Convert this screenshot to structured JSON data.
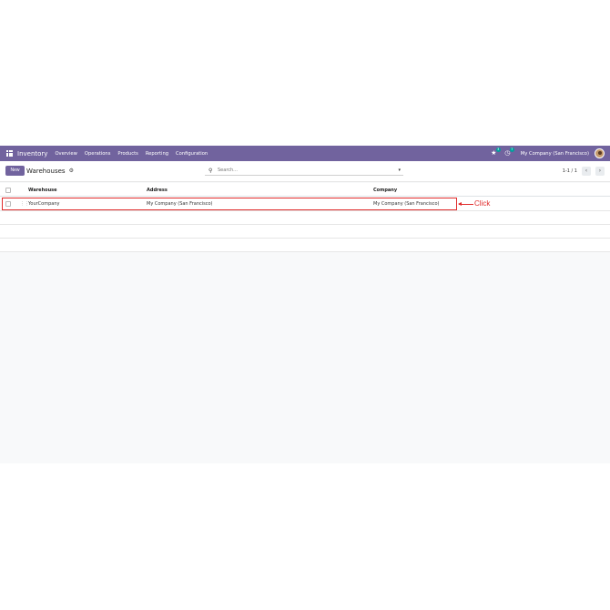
{
  "navbar": {
    "app_name": "Inventory",
    "menu": [
      "Overview",
      "Operations",
      "Products",
      "Reporting",
      "Configuration"
    ],
    "chat_badge": "3",
    "activity_badge": "7",
    "company": "My Company (San Francisco)"
  },
  "controlbar": {
    "new_label": "New",
    "title": "Warehouses",
    "search_placeholder": "Search...",
    "pager": "1-1 / 1"
  },
  "table": {
    "headers": [
      "Warehouse",
      "Address",
      "Company"
    ],
    "rows": [
      {
        "warehouse": "YourCompany",
        "address": "My Company (San Francisco)",
        "company": "My Company (San Francisco)"
      }
    ]
  },
  "annotation": {
    "label": "Click",
    "color": "#e02b2b"
  },
  "colors": {
    "brand": "#71639e",
    "badge": "#00a09d"
  }
}
